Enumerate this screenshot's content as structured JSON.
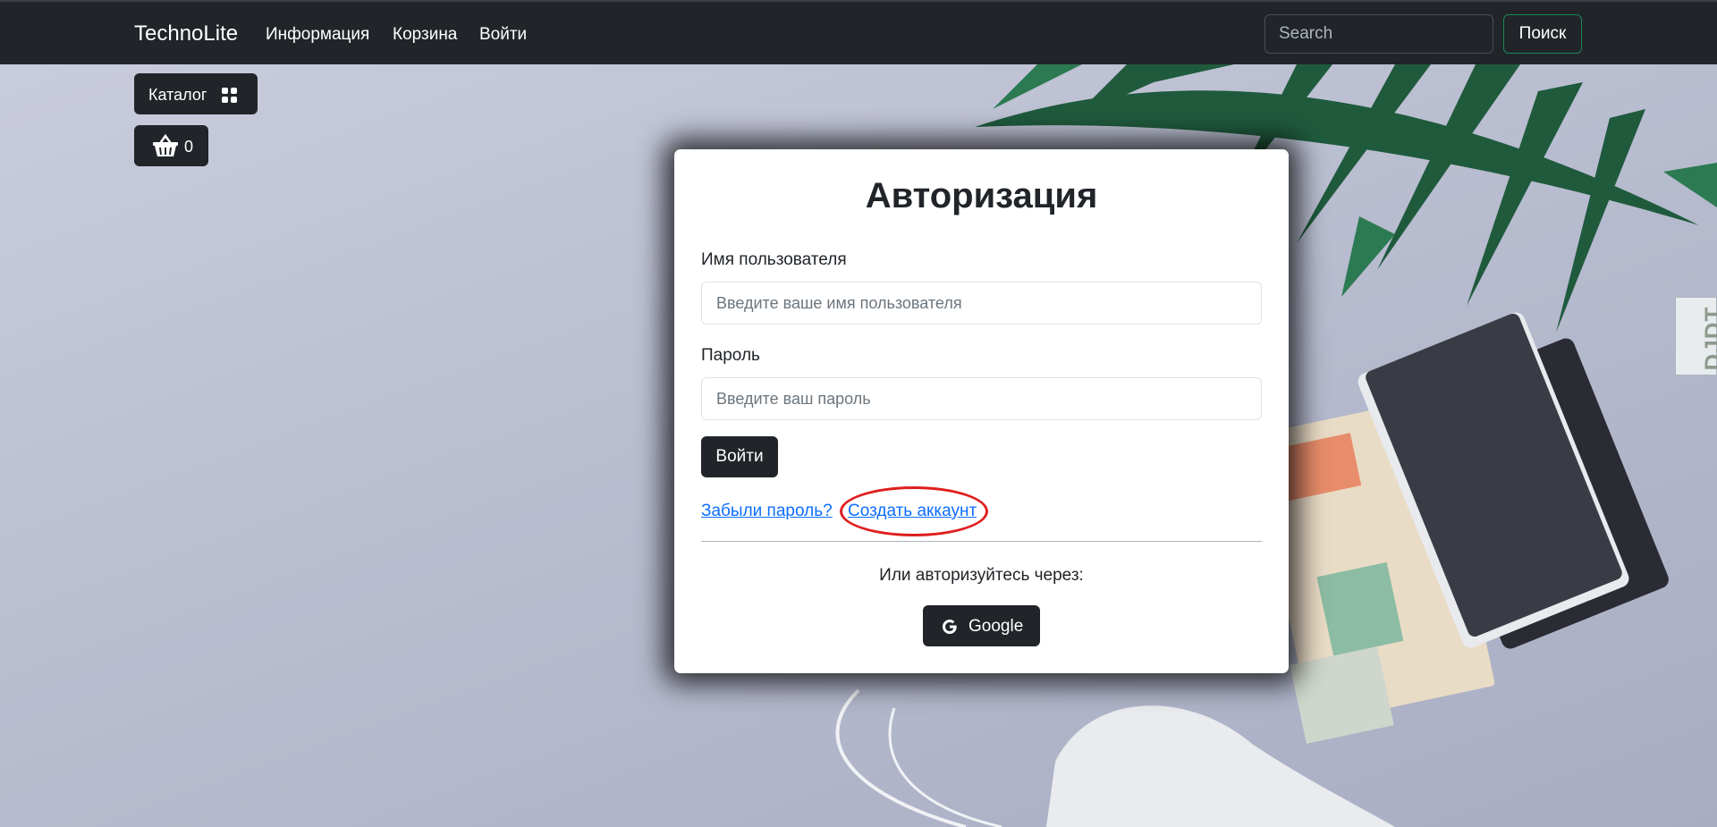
{
  "navbar": {
    "brand": "TechnoLite",
    "links": [
      "Информация",
      "Корзина",
      "Войти"
    ],
    "search_placeholder": "Search",
    "search_button": "Поиск"
  },
  "sidebar": {
    "catalog_label": "Каталог",
    "catalog_icon": "grid-icon",
    "cart_icon": "basket-icon",
    "cart_count": "0"
  },
  "login": {
    "title": "Авторизация",
    "username_label": "Имя пользователя",
    "username_placeholder": "Введите ваше имя пользователя",
    "password_label": "Пароль",
    "password_placeholder": "Введите ваш пароль",
    "submit_label": "Войти",
    "forgot_link": "Забыли пароль?",
    "register_link": "Создать аккаунт",
    "or_text": "Или авторизуйтесь через:",
    "google_label": "Google",
    "google_icon": "google-icon"
  },
  "extension": {
    "label": "DJDT"
  },
  "colors": {
    "navbar_bg": "#212529",
    "link": "#0d6efd",
    "search_border": "#198754",
    "highlight": "#e01e1e"
  }
}
